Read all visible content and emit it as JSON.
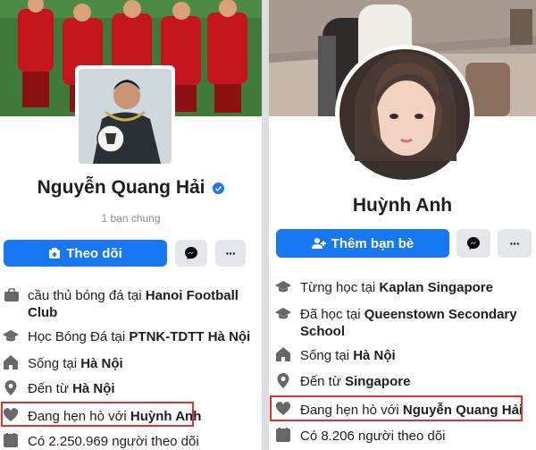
{
  "left": {
    "name": "Nguyễn Quang Hải",
    "mutual": "1 bạn chung",
    "follow_label": "Theo dõi",
    "messenger_icon": "messenger-icon",
    "more_label": "···",
    "info": [
      {
        "icon": "work-icon",
        "prefix": "cầu thủ bóng đá tại ",
        "bold": "Hanoi Football Club",
        "suffix": ""
      },
      {
        "icon": "education-icon",
        "prefix": "Học Bóng Đá tại ",
        "bold": "PTNK-TDTT Hà Nội",
        "suffix": ""
      },
      {
        "icon": "home-icon",
        "prefix": "Sống tại ",
        "bold": "Hà Nội",
        "suffix": ""
      },
      {
        "icon": "location-icon",
        "prefix": "Đến từ ",
        "bold": "Hà Nội",
        "suffix": ""
      },
      {
        "icon": "heart-icon",
        "prefix": "Đang hẹn hò với ",
        "bold": "Huỳnh Anh",
        "suffix": ""
      },
      {
        "icon": "followers-icon",
        "prefix": "Có 2.250.969 người theo dõi",
        "bold": "",
        "suffix": ""
      }
    ]
  },
  "right": {
    "name": "Huỳnh Anh",
    "add_friend_label": "Thêm bạn bè",
    "messenger_icon": "messenger-icon",
    "more_label": "···",
    "info": [
      {
        "icon": "education-icon",
        "prefix": "Từng học tại ",
        "bold": "Kaplan Singapore",
        "suffix": ""
      },
      {
        "icon": "education-icon",
        "prefix": "Đã học tại ",
        "bold": "Queenstown Secondary School",
        "suffix": ""
      },
      {
        "icon": "home-icon",
        "prefix": "Sống tại ",
        "bold": "Hà Nội",
        "suffix": ""
      },
      {
        "icon": "location-icon",
        "prefix": "Đến từ ",
        "bold": "Singapore",
        "suffix": ""
      },
      {
        "icon": "heart-icon",
        "prefix": "Đang hẹn hò với ",
        "bold": "Nguyễn Quang Hải",
        "suffix": ""
      },
      {
        "icon": "followers-icon",
        "prefix": "Có 8.206 người theo dõi",
        "bold": "",
        "suffix": ""
      }
    ]
  },
  "colors": {
    "accent": "#1877f2",
    "highlight": "#e0312c",
    "text": "#1c1e21",
    "icon": "#65676b"
  }
}
